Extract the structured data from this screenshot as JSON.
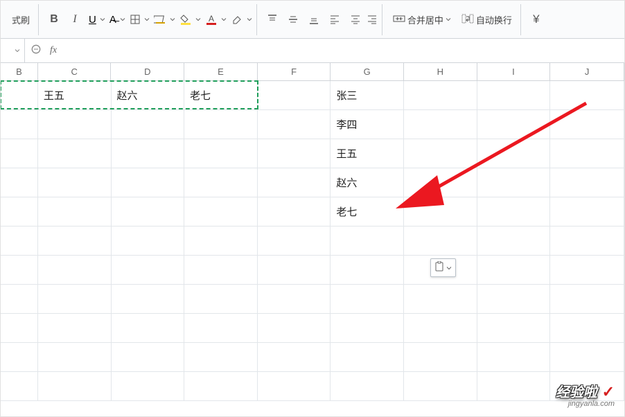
{
  "toolbar": {
    "format_painter": "式刷",
    "merge_center": "合并居中",
    "auto_wrap": "自动换行"
  },
  "formula_bar": {
    "fx_label": "fx",
    "value": ""
  },
  "columns": [
    "B",
    "C",
    "D",
    "E",
    "F",
    "G",
    "H",
    "I",
    "J"
  ],
  "cells": {
    "row1": {
      "C": "王五",
      "D": "赵六",
      "E": "老七"
    },
    "colG": [
      "张三",
      "李四",
      "王五",
      "赵六",
      "老七"
    ]
  },
  "watermark": {
    "main": "经验啦",
    "sub": "jingyanla.com"
  }
}
